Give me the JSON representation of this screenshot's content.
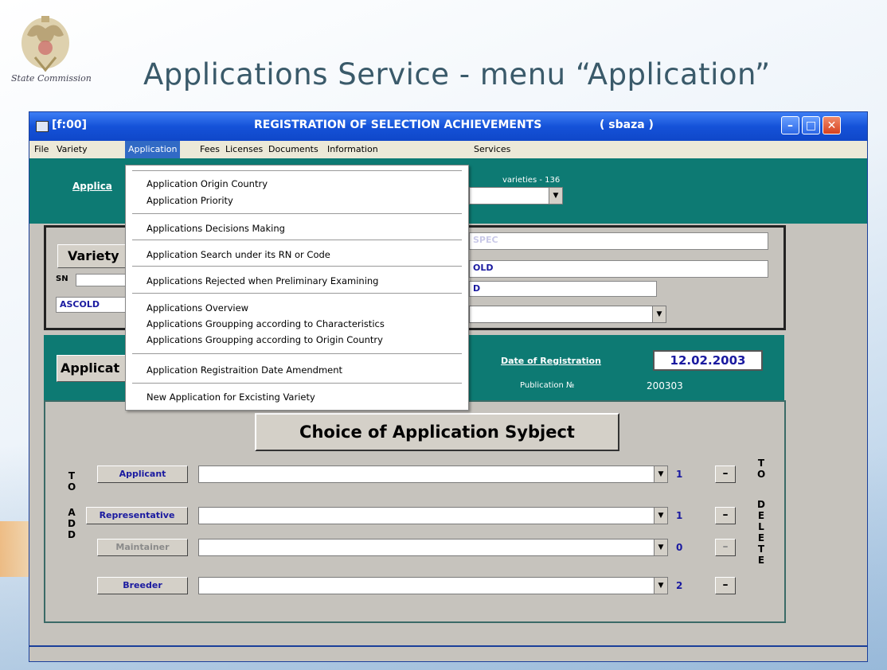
{
  "slide": {
    "crest_caption": "State Commission",
    "title": "Applications  Service - menu “Application”"
  },
  "window": {
    "code": "[f:00]",
    "title": "REGISTRATION OF SELECTION ACHIEVEMENTS",
    "db": "( sbaza )"
  },
  "menu": {
    "items": [
      "File",
      "Variety",
      "Application",
      "Fees",
      "Licenses",
      "Documents",
      "Information",
      "Services"
    ],
    "active": "Application"
  },
  "dropdown": {
    "items": [
      "Application Origin Country",
      "Application Priority",
      "Applications Decisions Making",
      "Application Search under its RN or Code",
      "Applications Rejected when Preliminary Examining",
      "Applications Overview",
      "Applications Groupping according to Characteristics",
      "Applications Groupping according to Origin Country",
      "Application Registraition Date Amendment",
      "New Application for Excisting Variety"
    ]
  },
  "top_band": {
    "applic_link": "Applica",
    "varieties_label": "varieties - 136"
  },
  "variety_panel": {
    "variety_button": "Variety",
    "sn_label": "SN",
    "ascold": "ASCOLD",
    "field1": "SPEC",
    "field2": "OLD",
    "field3": "D"
  },
  "application_band": {
    "applic_button": "Applicat",
    "date_label": "Date of Registration",
    "date_value": "12.02.2003",
    "publication_label": "Publication  №",
    "publication_value": "200303"
  },
  "choice": {
    "title": "Choice of Application Sybject",
    "to_add": [
      "T",
      "O",
      "A",
      "D",
      "D"
    ],
    "to_delete": [
      "T",
      "O",
      "D",
      "E",
      "L",
      "E",
      "T",
      "E"
    ],
    "rows": [
      {
        "label": "Applicant",
        "count": "1",
        "enabled": true
      },
      {
        "label": "Representative",
        "count": "1",
        "enabled": true
      },
      {
        "label": "Maintainer",
        "count": "0",
        "enabled": false
      },
      {
        "label": "Breeder",
        "count": "2",
        "enabled": true
      }
    ],
    "minus": "–"
  },
  "icons": {
    "minimize": "–",
    "maximize": "□",
    "close": "✕",
    "combo": "▼"
  },
  "colors": {
    "teal": "#0d7a73",
    "titlebar": "#1552d8",
    "menu_highlight": "#316ac5",
    "value_blue": "#1a1aa0"
  }
}
